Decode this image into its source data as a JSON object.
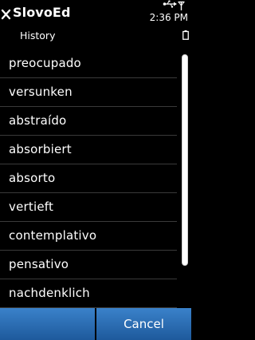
{
  "header": {
    "title": "SlovoEd",
    "subtitle": "History"
  },
  "status_bar": {
    "time": "2:36 PM"
  },
  "history": {
    "items": [
      {
        "label": "preocupado"
      },
      {
        "label": "versunken"
      },
      {
        "label": "abstraído"
      },
      {
        "label": "absorbiert"
      },
      {
        "label": "absorto"
      },
      {
        "label": "vertieft"
      },
      {
        "label": "contemplativo"
      },
      {
        "label": "pensativo"
      },
      {
        "label": "nachdenklich"
      }
    ],
    "scroll_position": 0.0,
    "scroll_visible_fraction": 0.85
  },
  "softkeys": {
    "left_label": "",
    "right_label": "Cancel"
  },
  "colors": {
    "softkey_top": "#3a82ca",
    "softkey_bottom": "#1e5a9c",
    "background": "#000000",
    "separator": "#3a3a3a"
  }
}
